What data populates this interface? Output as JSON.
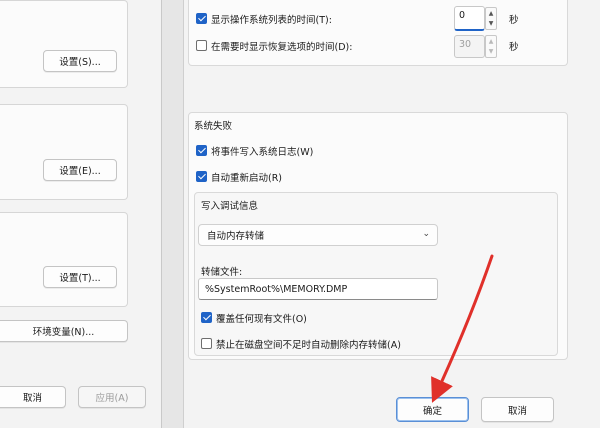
{
  "left_window": {
    "settings_s": "设置(S)...",
    "settings_e": "设置(E)...",
    "settings_t": "设置(T)...",
    "env_vars": "环境变量(N)...",
    "cancel": "取消",
    "apply": "应用(A)"
  },
  "dialog": {
    "show_os_list_time": {
      "label": "显示操作系统列表的时间(T):",
      "checked": true,
      "value": "0",
      "unit": "秒"
    },
    "show_recovery_time": {
      "label": "在需要时显示恢复选项的时间(D):",
      "checked": false,
      "value": "30",
      "unit": "秒"
    },
    "system_failure": {
      "title": "系统失败",
      "write_event": {
        "label": "将事件写入系统日志(W)",
        "checked": true
      },
      "auto_restart": {
        "label": "自动重新启动(R)",
        "checked": true
      }
    },
    "debug_info": {
      "title": "写入调试信息",
      "dump_type": "自动内存转储",
      "dump_file_label": "转储文件:",
      "dump_file_value": "%SystemRoot%\\MEMORY.DMP",
      "overwrite": {
        "label": "覆盖任何现有文件(O)",
        "checked": true
      },
      "disable_auto_delete": {
        "label": "禁止在磁盘空间不足时自动删除内存转储(A)",
        "checked": false
      }
    },
    "ok": "确定",
    "cancel": "取消"
  },
  "annotation": {
    "arrow_color": "#e0302a"
  }
}
